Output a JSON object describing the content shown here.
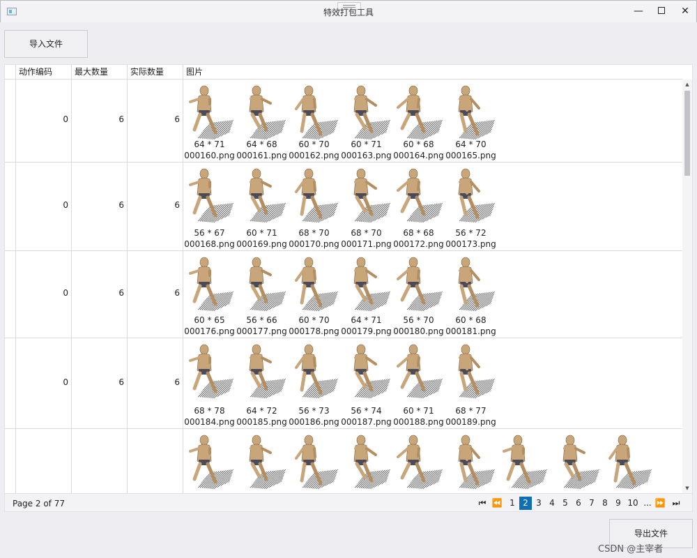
{
  "window": {
    "title": "特效打包工具",
    "minimize": "—",
    "close": "✕"
  },
  "toolbar": {
    "import_label": "导入文件",
    "export_label": "导出文件"
  },
  "grid": {
    "columns": [
      "动作编码",
      "最大数量",
      "实际数量",
      "图片"
    ],
    "rows": [
      {
        "code": "0",
        "max": "6",
        "actual": "6",
        "frames": [
          {
            "dims": "64 * 71",
            "file": "000160.png"
          },
          {
            "dims": "64 * 68",
            "file": "000161.png"
          },
          {
            "dims": "60 * 70",
            "file": "000162.png"
          },
          {
            "dims": "60 * 71",
            "file": "000163.png"
          },
          {
            "dims": "60 * 68",
            "file": "000164.png"
          },
          {
            "dims": "64 * 70",
            "file": "000165.png"
          }
        ]
      },
      {
        "code": "0",
        "max": "6",
        "actual": "6",
        "frames": [
          {
            "dims": "56 * 67",
            "file": "000168.png"
          },
          {
            "dims": "60 * 71",
            "file": "000169.png"
          },
          {
            "dims": "68 * 70",
            "file": "000170.png"
          },
          {
            "dims": "68 * 70",
            "file": "000171.png"
          },
          {
            "dims": "68 * 68",
            "file": "000172.png"
          },
          {
            "dims": "56 * 72",
            "file": "000173.png"
          }
        ]
      },
      {
        "code": "0",
        "max": "6",
        "actual": "6",
        "frames": [
          {
            "dims": "60 * 65",
            "file": "000176.png"
          },
          {
            "dims": "56 * 66",
            "file": "000177.png"
          },
          {
            "dims": "60 * 70",
            "file": "000178.png"
          },
          {
            "dims": "64 * 71",
            "file": "000179.png"
          },
          {
            "dims": "56 * 70",
            "file": "000180.png"
          },
          {
            "dims": "60 * 68",
            "file": "000181.png"
          }
        ]
      },
      {
        "code": "0",
        "max": "6",
        "actual": "6",
        "frames": [
          {
            "dims": "68 * 78",
            "file": "000184.png"
          },
          {
            "dims": "64 * 72",
            "file": "000185.png"
          },
          {
            "dims": "56 * 73",
            "file": "000186.png"
          },
          {
            "dims": "56 * 74",
            "file": "000187.png"
          },
          {
            "dims": "60 * 71",
            "file": "000188.png"
          },
          {
            "dims": "68 * 77",
            "file": "000189.png"
          }
        ]
      },
      {
        "code": "",
        "max": "",
        "actual": "",
        "frames": [
          {
            "dims": "",
            "file": ""
          },
          {
            "dims": "",
            "file": ""
          },
          {
            "dims": "",
            "file": ""
          },
          {
            "dims": "",
            "file": ""
          },
          {
            "dims": "",
            "file": ""
          },
          {
            "dims": "",
            "file": ""
          },
          {
            "dims": "",
            "file": ""
          },
          {
            "dims": "",
            "file": ""
          },
          {
            "dims": "",
            "file": ""
          }
        ]
      }
    ]
  },
  "pager": {
    "info": "Page 2 of 77",
    "first": "⏮",
    "prev": "⏪",
    "next": "⏩",
    "last": "⏭",
    "pages": [
      "1",
      "2",
      "3",
      "4",
      "5",
      "6",
      "7",
      "8",
      "9",
      "10",
      "..."
    ],
    "current": "2"
  },
  "colors": {
    "accent": "#0e6fb5",
    "skin": "#c9a57a",
    "shadow": "#6f6f6f"
  },
  "icons": [
    "app-icon",
    "minimize-icon",
    "maximize-icon",
    "close-icon",
    "scroll-up-icon",
    "scroll-down-icon"
  ],
  "watermark": "CSDN @主宰者"
}
